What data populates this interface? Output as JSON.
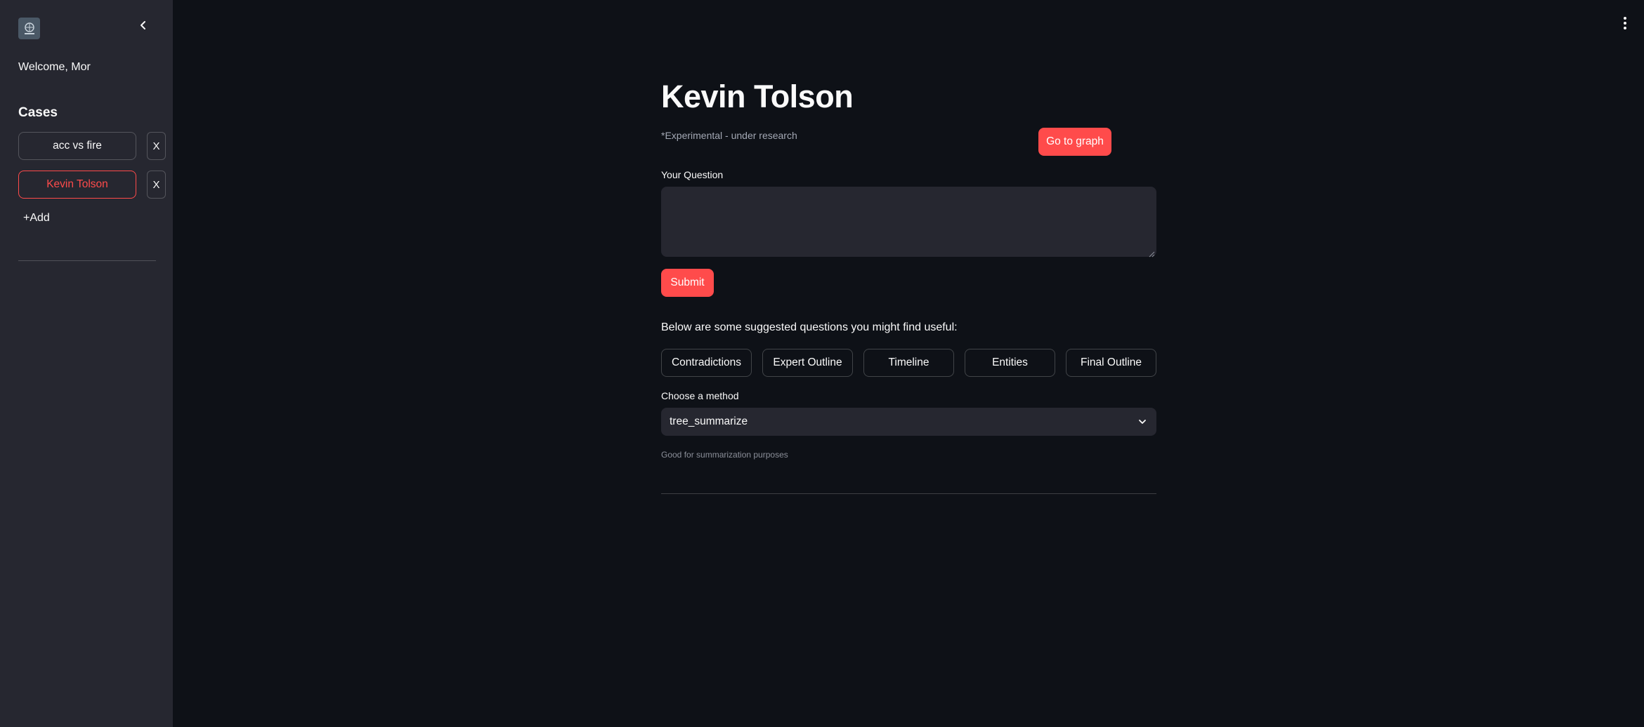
{
  "sidebar": {
    "welcome": "Welcome, Mor",
    "cases_title": "Cases",
    "cases": [
      {
        "label": "acc vs fire",
        "remove_label": "X",
        "active": false
      },
      {
        "label": "Kevin Tolson",
        "remove_label": "X",
        "active": true
      }
    ],
    "add_label": "+Add"
  },
  "main": {
    "title": "Kevin Tolson",
    "subtitle": "*Experimental - under research",
    "graph_button": "Go to graph",
    "question_label": "Your Question",
    "question_value": "",
    "submit_label": "Submit",
    "suggest_text": "Below are some suggested questions you might find useful:",
    "suggestions": [
      "Contradictions",
      "Expert Outline",
      "Timeline",
      "Entities",
      "Final Outline"
    ],
    "method_label": "Choose a method",
    "method_value": "tree_summarize",
    "method_help": "Good for summarization purposes"
  },
  "colors": {
    "background": "#0e1117",
    "sidebar": "#262730",
    "accent": "#ff4b4b",
    "text": "#fafafa"
  },
  "icons": {
    "logo": "app-logo-icon",
    "collapse": "chevron-left-icon",
    "menu": "more-vertical-icon",
    "select": "chevron-down-icon"
  }
}
